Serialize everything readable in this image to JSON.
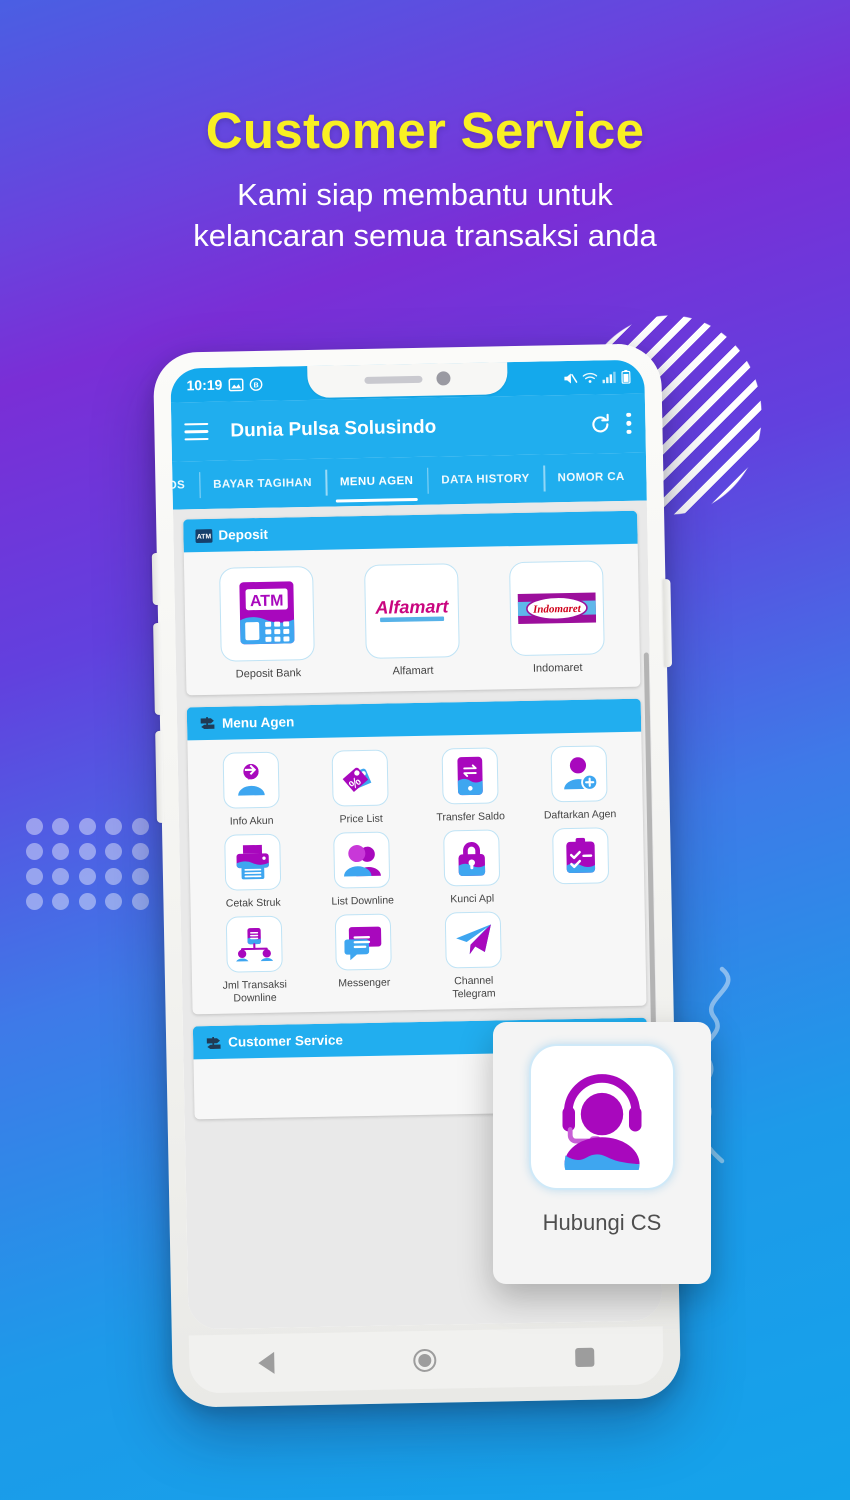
{
  "headline": {
    "title": "Customer Service",
    "subtitle_line1": "Kami siap membantu untuk",
    "subtitle_line2": "kelancaran semua transaksi anda",
    "title_color": "#f9f023",
    "subtitle_color": "#ffffff"
  },
  "background": {
    "gradient_from": "#4a5fe3",
    "gradient_mid": "#7a2ed6",
    "gradient_to": "#14a3ea"
  },
  "phone": {
    "statusbar": {
      "time": "10:19",
      "left_icons": [
        "image-icon",
        "badge-icon"
      ],
      "right_icons": [
        "mute-icon",
        "wifi-icon",
        "signal-icon",
        "battery-icon"
      ]
    },
    "appbar": {
      "menu_icon": "hamburger-icon",
      "title": "Dunia Pulsa Solusindo",
      "refresh_icon": "refresh-icon",
      "overflow_icon": "kebab-menu-icon",
      "bg_color": "#20aeee"
    },
    "tabs": [
      {
        "label": "DIGIPOS",
        "active": false
      },
      {
        "label": "BAYAR TAGIHAN",
        "active": false
      },
      {
        "label": "MENU AGEN",
        "active": true
      },
      {
        "label": "DATA HISTORY",
        "active": false
      },
      {
        "label": "NOMOR CA",
        "active": false
      }
    ],
    "sections": [
      {
        "header": "Deposit",
        "header_icon": "atm-badge-icon",
        "columns": 3,
        "items": [
          {
            "label": "Deposit Bank",
            "icon": "atm-machine-icon"
          },
          {
            "label": "Alfamart",
            "icon": "alfamart-logo"
          },
          {
            "label": "Indomaret",
            "icon": "indomaret-logo"
          }
        ]
      },
      {
        "header": "Menu Agen",
        "header_icon": "signpost-icon",
        "columns": 4,
        "items": [
          {
            "label": "Info Akun",
            "icon": "user-login-icon"
          },
          {
            "label": "Price List",
            "icon": "price-tag-icon"
          },
          {
            "label": "Transfer Saldo",
            "icon": "phone-transfer-icon"
          },
          {
            "label": "Daftarkan Agen",
            "icon": "add-user-icon"
          },
          {
            "label": "Cetak Struk",
            "icon": "printer-icon"
          },
          {
            "label": "List Downline",
            "icon": "users-group-icon"
          },
          {
            "label": "Kunci Apl",
            "icon": "lock-icon"
          },
          {
            "label": "",
            "icon": "clipboard-check-icon"
          },
          {
            "label": "Jml Transaksi\nDownline",
            "icon": "org-chart-icon"
          },
          {
            "label": "Messenger",
            "icon": "chat-bubbles-icon"
          },
          {
            "label": "Channel\nTelegram",
            "icon": "telegram-plane-icon"
          },
          {
            "label": "",
            "icon": ""
          }
        ]
      },
      {
        "header": "Customer Service",
        "header_icon": "signpost-icon",
        "columns": 4,
        "items": []
      }
    ],
    "navbar": {
      "back": "back-triangle-icon",
      "home": "home-circle-icon",
      "recents": "recents-square-icon"
    }
  },
  "cs_overlay": {
    "label": "Hubungi CS",
    "icon": "headset-support-icon",
    "icon_color_primary": "#a808bd",
    "icon_color_secondary": "#3ea6f0"
  },
  "decorations": {
    "stripe_circle": "diagonal-stripes-circle",
    "dot_grid": "dot-grid-decoration",
    "squiggle": "wavy-line-decoration"
  }
}
